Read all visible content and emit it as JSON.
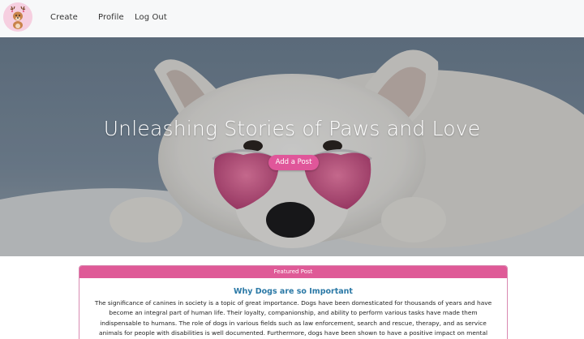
{
  "nav": {
    "logo_icon": "dog-logo-icon",
    "links": [
      "Create",
      "Profile",
      "Log Out"
    ]
  },
  "hero": {
    "title": "Unleashing Stories of Paws and Love",
    "button_label": "Add a Post",
    "image": "white-dog-with-pink-heart-sunglasses"
  },
  "featured": {
    "header": "Featured Post",
    "title": "Why Dogs are so Important",
    "body": "The significance of canines in society is a topic of great importance. Dogs have been domesticated for thousands of years and have become an integral part of human life. Their loyalty, companionship, and ability to perform various tasks have made them indispensable to humans. The role of dogs in various fields such as law enforcement, search and rescue, therapy, and as service animals for people with disabilities is well documented. Furthermore, dogs have been shown to have a positive impact on mental"
  },
  "colors": {
    "accent": "#df5a97",
    "title_blue": "#2b79a6",
    "navbar_bg": "#f7f8f9"
  }
}
